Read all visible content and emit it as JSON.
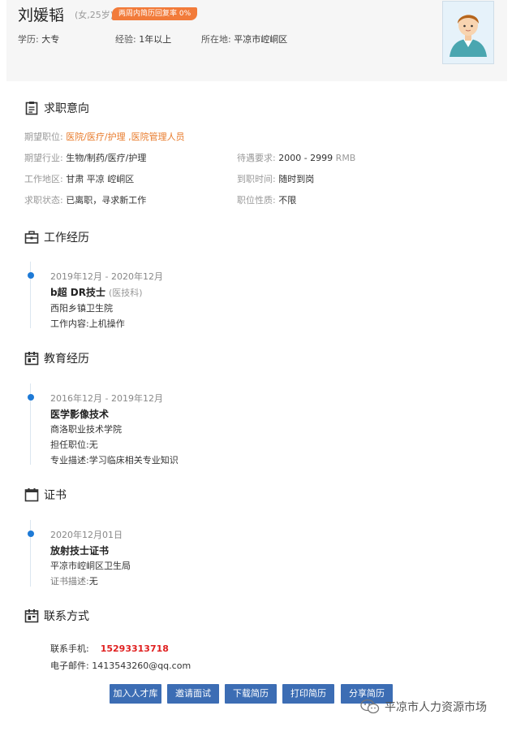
{
  "profile": {
    "name": "刘媛韬",
    "gender_age": "(女,25岁)",
    "reply_rate": "两周内简历回复率 0%",
    "education_label": "学历:",
    "education": "大专",
    "experience_label": "经验:",
    "experience": "1年以上",
    "location_label": "所在地:",
    "location": "平凉市崆峒区"
  },
  "intent": {
    "title": "求职意向",
    "position_label": "期望职位:",
    "position": "医院/医疗/护理 ,医院管理人员",
    "industry_label": "期望行业:",
    "industry": "生物/制药/医疗/护理",
    "salary_label": "待遇要求:",
    "salary": "2000 - 2999",
    "salary_unit": "RMB",
    "area_label": "工作地区:",
    "area": "甘肃 平凉 崆峒区",
    "arrival_label": "到职时间:",
    "arrival": "随时到岗",
    "status_label": "求职状态:",
    "status": "已离职，寻求新工作",
    "nature_label": "职位性质:",
    "nature": "不限"
  },
  "work": {
    "title": "工作经历",
    "date": "2019年12月 - 2020年12月",
    "job": "b超 DR技士",
    "dept": "(医技科)",
    "company": "西阳乡镇卫生院",
    "content_label": "工作内容:",
    "content": "上机操作"
  },
  "education": {
    "title": "教育经历",
    "date": "2016年12月 - 2019年12月",
    "major": "医学影像技术",
    "school": "商洛职业技术学院",
    "role_label": "担任职位:",
    "role": "无",
    "desc_label": "专业描述:",
    "desc": "学习临床相关专业知识"
  },
  "certificate": {
    "title": "证书",
    "date": "2020年12月01日",
    "name": "放射技士证书",
    "issuer": "平凉市崆峒区卫生局",
    "desc_label": "证书描述:",
    "desc": "无"
  },
  "contact": {
    "title": "联系方式",
    "phone_label": "联系手机:",
    "phone": "15293313718",
    "email_label": "电子邮件:",
    "email": "1413543260@qq.com"
  },
  "actions": {
    "add_talent": "加入人才库",
    "invite": "邀请面试",
    "download": "下载简历",
    "print": "打印简历",
    "share": "分享简历"
  },
  "watermark": {
    "text": "平凉市人力资源市场"
  },
  "colors": {
    "accent_blue": "#3c6db4",
    "badge_orange": "#f27b3a",
    "phone_red": "#e02020",
    "timeline_dot": "#1e7ad6"
  }
}
